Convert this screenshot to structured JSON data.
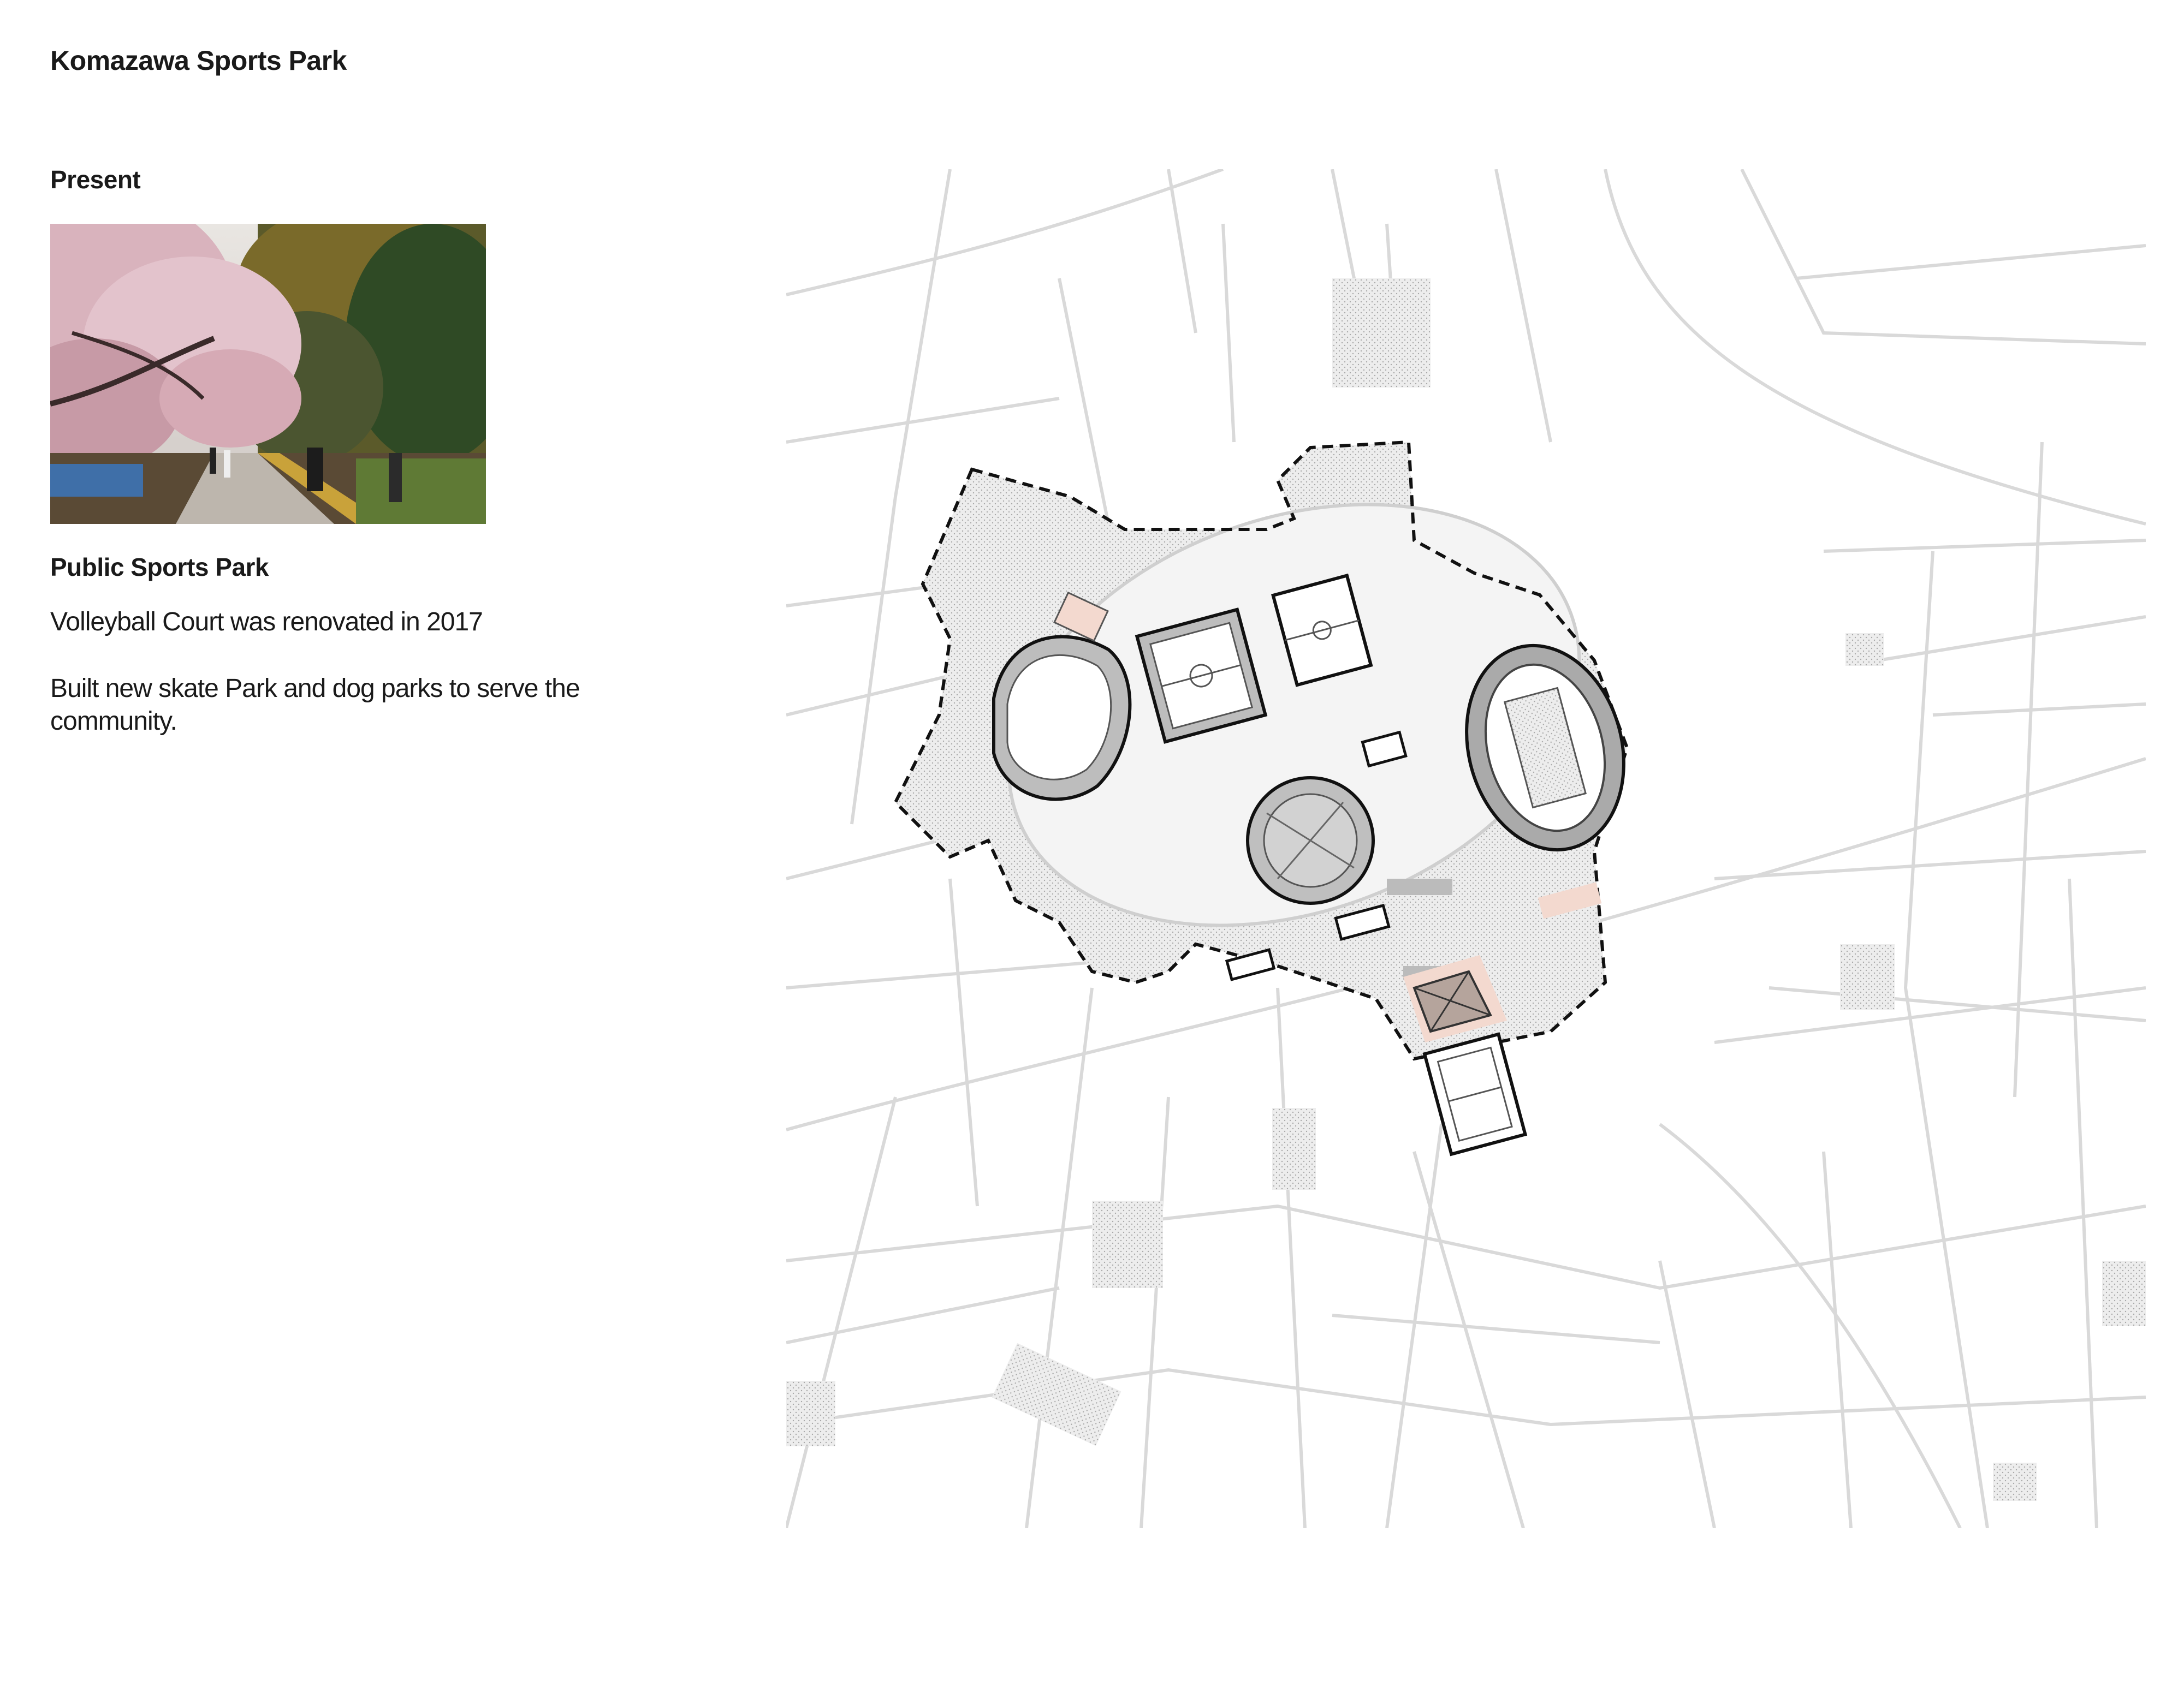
{
  "header": {
    "title": "Komazawa Sports Park"
  },
  "section": {
    "label": "Present"
  },
  "photo": {
    "subject": "cherry blossom path in park"
  },
  "park": {
    "label": "Public Sports Park",
    "notes": [
      "Volleyball Court was renovated in 2017",
      "Built new skate Park and dog parks to serve the community."
    ]
  },
  "map": {
    "colors": {
      "streets": "#d9d9d9",
      "park_fill": "#eeeeee",
      "boundary": "#111111",
      "highlight": "#f3d9cf",
      "building": "#cfcfcf"
    }
  }
}
